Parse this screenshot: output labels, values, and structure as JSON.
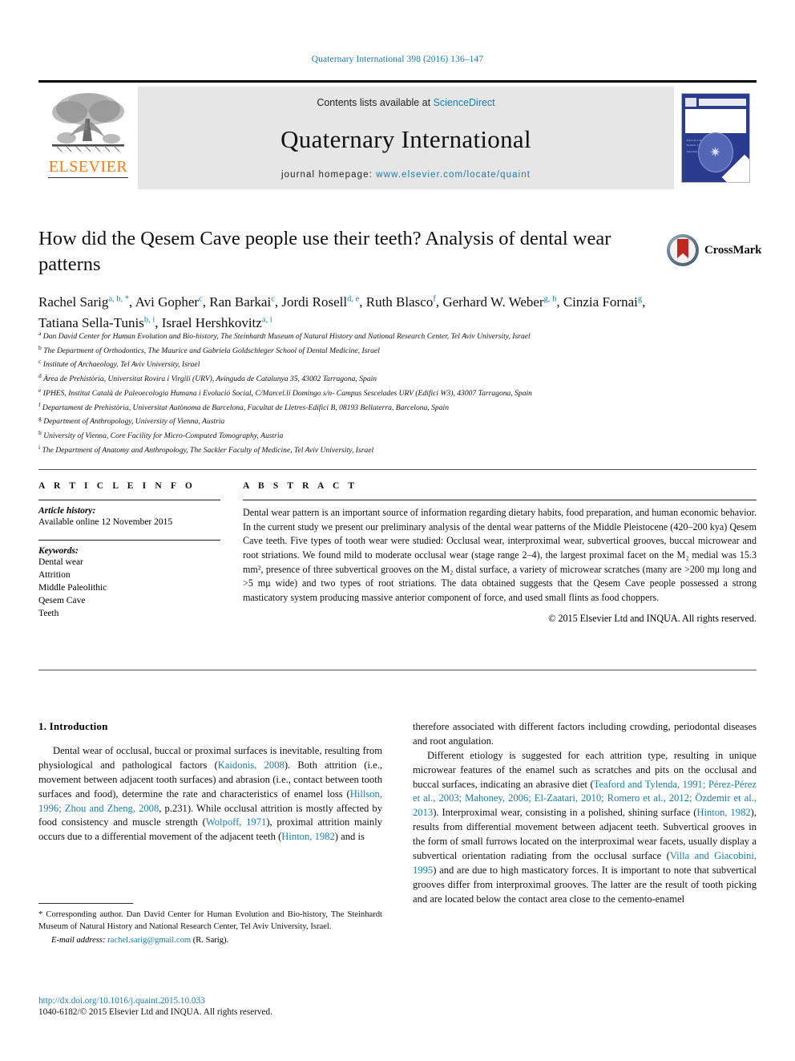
{
  "running_head": "Quaternary International 398 (2016) 136–147",
  "masthead": {
    "contents_prefix": "Contents lists available at ",
    "contents_link": "ScienceDirect",
    "journal_name": "Quaternary International",
    "homepage_prefix": "journal homepage: ",
    "homepage_link": "www.elsevier.com/locate/quaint",
    "publisher_logo_text": "ELSEVIER",
    "cover_title": "QUATERNARY INTERNATIONAL",
    "cover_subtitle": "The Journal of the International Union for Quaternary Research",
    "cover_editor_label": "Editor-in-Chief",
    "cover_editor_name": "Norm R. Catto",
    "cover_assoc_label": "Associate Editors",
    "colors": {
      "link": "#1b7eaa",
      "elsevier_orange": "#f07f13",
      "masthead_grey": "#e6e6e6",
      "cover_blue": "#2b3b8f"
    }
  },
  "crossmark": {
    "label": "CrossMark"
  },
  "article": {
    "title": "How did the Qesem Cave people use their teeth? Analysis of dental wear patterns",
    "authors": [
      {
        "name": "Rachel Sarig",
        "marks": "a, b, *"
      },
      {
        "name": "Avi Gopher",
        "marks": "c"
      },
      {
        "name": "Ran Barkai",
        "marks": "c"
      },
      {
        "name": "Jordi Rosell",
        "marks": "d, e"
      },
      {
        "name": "Ruth Blasco",
        "marks": "f"
      },
      {
        "name": "Gerhard W. Weber",
        "marks": "g, h"
      },
      {
        "name": "Cinzia Fornai",
        "marks": "g"
      },
      {
        "name": "Tatiana Sella-Tunis",
        "marks": "b, i"
      },
      {
        "name": "Israel Hershkovitz",
        "marks": "a, i"
      }
    ],
    "affiliations": [
      {
        "mark": "a",
        "text": "Dan David Center for Human Evolution and Bio-history, The Steinhardt Museum of Natural History and National Research Center, Tel Aviv University, Israel"
      },
      {
        "mark": "b",
        "text": "The Department of Orthodontics, The Maurice and Gabriela Goldschleger School of Dental Medicine, Israel"
      },
      {
        "mark": "c",
        "text": "Institute of Archaeology, Tel Aviv University, Israel"
      },
      {
        "mark": "d",
        "text": "Àrea de Prehistòria, Universitat Rovira i Virgili (URV), Avinguda de Catalunya 35, 43002 Tarragona, Spain"
      },
      {
        "mark": "e",
        "text": "IPHES, Institut Català de Paleoecologia Humana i Evolució Social, C/Marcel.lí Domingo s/n- Campus Sescelades URV (Edifici W3), 43007 Tarragona, Spain"
      },
      {
        "mark": "f",
        "text": "Departament de Prehistòria, Universitat Autònoma de Barcelona, Facultat de Lletres-Edifici B, 08193 Bellaterra, Barcelona, Spain"
      },
      {
        "mark": "g",
        "text": "Department of Anthropology, University of Vienna, Austria"
      },
      {
        "mark": "h",
        "text": "University of Vienna, Core Facility for Micro-Computed Tomography, Austria"
      },
      {
        "mark": "i",
        "text": "The Department of Anatomy and Anthropology, The Sackler Faculty of Medicine, Tel Aviv University, Israel"
      }
    ]
  },
  "article_info": {
    "heading": "A R T I C L E  I N F O",
    "history_label": "Article history:",
    "history_value": "Available online 12 November 2015",
    "keywords_label": "Keywords:",
    "keywords": [
      "Dental wear",
      "Attrition",
      "Middle Paleolithic",
      "Qesem Cave",
      "Teeth"
    ]
  },
  "abstract": {
    "heading": "A B S T R A C T",
    "paragraph": "Dental wear pattern is an important source of information regarding dietary habits, food preparation, and human economic behavior. In the current study we present our preliminary analysis of the dental wear patterns of the Middle Pleistocene (420–200 kya) Qesem Cave teeth. Five types of tooth wear were studied: Occlusal wear, interproximal wear, subvertical grooves, buccal microwear and root striations. We found mild to moderate occlusal wear (stage range 2–4), the largest proximal facet on the M₂ medial was 15.3 mm², presence of three subvertical grooves on the M₂ distal surface, a variety of microwear scratches (many are >200 mμ long and >5 mμ wide) and two types of root striations. The data obtained suggests that the Qesem Cave people possessed a strong masticatory system producing massive anterior component of force, and used small flints as food choppers.",
    "copyright": "© 2015 Elsevier Ltd and INQUA. All rights reserved."
  },
  "body": {
    "section_number_title": "1. Introduction",
    "left_paragraphs": [
      "Dental wear of occlusal, buccal or proximal surfaces is inevitable, resulting from physiological and pathological factors (Kaidonis, 2008). Both attrition (i.e., movement between adjacent tooth surfaces) and abrasion (i.e., contact between tooth surfaces and food), determine the rate and characteristics of enamel loss (Hillson, 1996; Zhou and Zheng, 2008, p.231). While occlusal attrition is mostly affected by food consistency and muscle strength (Wolpoff, 1971), proximal attrition mainly occurs due to a differential movement of the adjacent teeth (Hinton, 1982) and is"
    ],
    "right_paragraphs": [
      "therefore associated with different factors including crowding, periodontal diseases and root angulation.",
      "Different etiology is suggested for each attrition type, resulting in unique microwear features of the enamel such as scratches and pits on the occlusal and buccal surfaces, indicating an abrasive diet (Teaford and Tylenda, 1991; Pérez-Pérez et al., 2003; Mahoney, 2006; El-Zaatari, 2010; Romero et al., 2012; Özdemir et al., 2013). Interproximal wear, consisting in a polished, shining surface (Hinton, 1982), results from differential movement between adjacent teeth. Subvertical grooves in the form of small furrows located on the interproximal wear facets, usually display a subvertical orientation radiating from the occlusal surface (Villa and Giacobini, 1995) and are due to high masticatory forces. It is important to note that subvertical grooves differ from interproximal grooves. The latter are the result of tooth picking and are located below the contact area close to the cemento-enamel"
    ]
  },
  "footnote": {
    "corresponding": "* Corresponding author. Dan David Center for Human Evolution and Bio-history, The Steinhardt Museum of Natural History and National Research Center, Tel Aviv University, Israel.",
    "email_label": "E-mail address:",
    "email": "rachel.sarig@gmail.com",
    "email_suffix": "(R. Sarig)."
  },
  "imprint": {
    "doi": "http://dx.doi.org/10.1016/j.quaint.2015.10.033",
    "issn_line": "1040-6182/© 2015 Elsevier Ltd and INQUA. All rights reserved."
  }
}
